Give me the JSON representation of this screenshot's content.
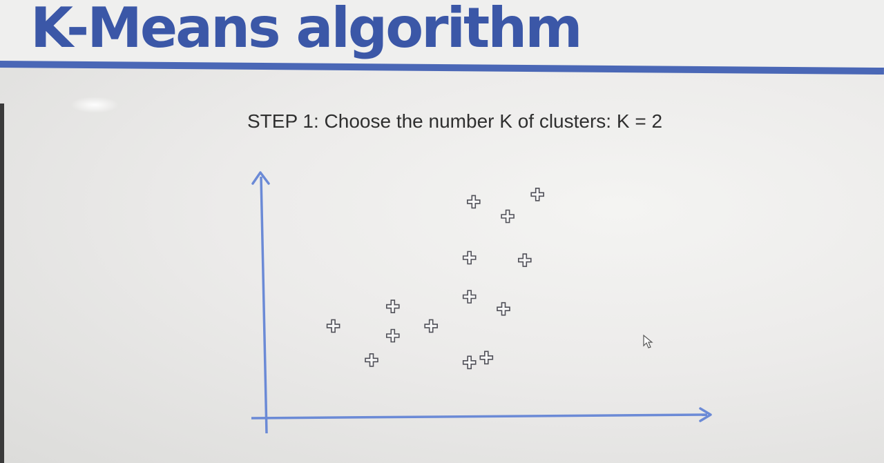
{
  "title": "K-Means algorithm",
  "step_text": "STEP 1: Choose the number K of clusters: K = 2",
  "colors": {
    "title": "#3b57a7",
    "rule": "#4a67b6",
    "axis": "#6b8ad6",
    "marker_stroke": "#4f4f57"
  },
  "icons": {
    "point_marker": "plus-cross-icon",
    "cursor": "mouse-pointer-icon"
  },
  "chart_data": {
    "type": "scatter",
    "title": "",
    "xlabel": "",
    "ylabel": "",
    "xlim": [
      0,
      10
    ],
    "ylim": [
      0,
      10
    ],
    "grid": false,
    "legend": "none",
    "series": [
      {
        "marker": "plus",
        "points": [
          {
            "x": 1.6,
            "y": 3.7
          },
          {
            "x": 2.5,
            "y": 2.3
          },
          {
            "x": 3.0,
            "y": 4.5
          },
          {
            "x": 3.0,
            "y": 3.3
          },
          {
            "x": 3.9,
            "y": 3.7
          },
          {
            "x": 4.8,
            "y": 4.9
          },
          {
            "x": 4.8,
            "y": 6.5
          },
          {
            "x": 4.9,
            "y": 8.8
          },
          {
            "x": 5.7,
            "y": 8.2
          },
          {
            "x": 5.6,
            "y": 4.4
          },
          {
            "x": 6.1,
            "y": 6.4
          },
          {
            "x": 6.4,
            "y": 9.1
          },
          {
            "x": 4.8,
            "y": 2.2
          },
          {
            "x": 5.2,
            "y": 2.4
          }
        ]
      }
    ]
  }
}
